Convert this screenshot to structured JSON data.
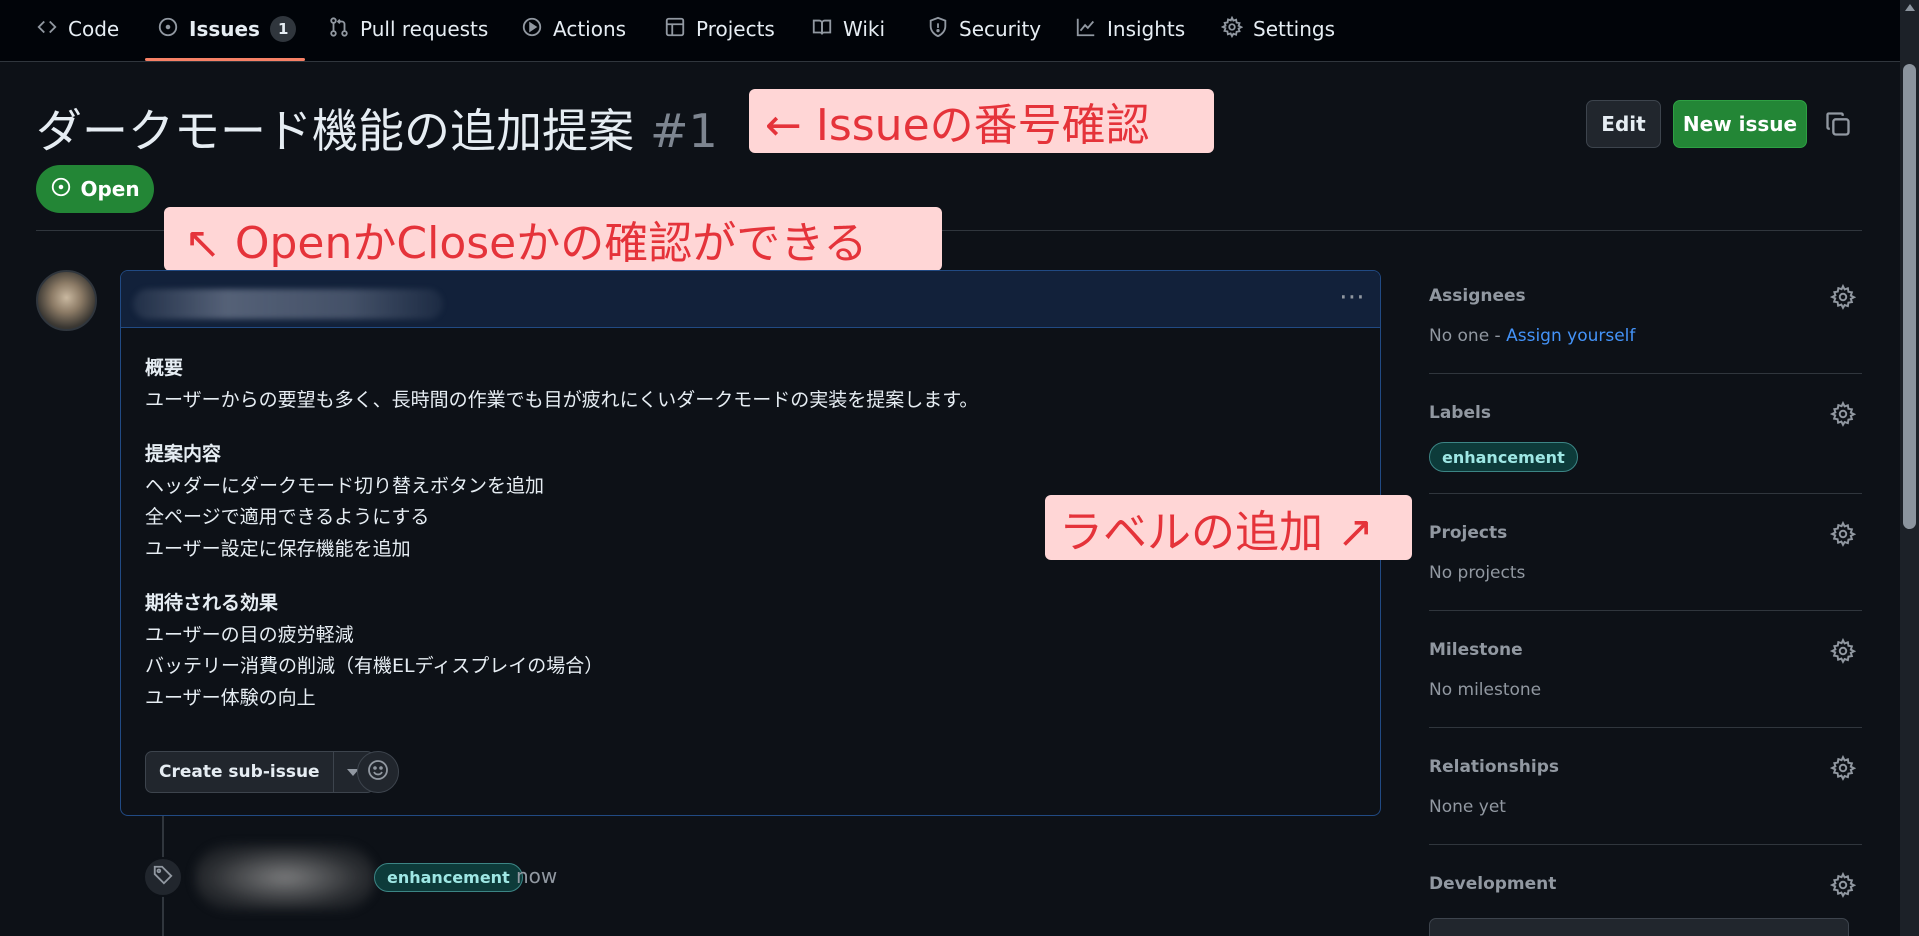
{
  "nav": {
    "tabs": [
      {
        "label": "Code",
        "icon": "code-icon"
      },
      {
        "label": "Issues",
        "icon": "issue-opened-icon",
        "count": "1"
      },
      {
        "label": "Pull requests",
        "icon": "git-pull-request-icon"
      },
      {
        "label": "Actions",
        "icon": "play-icon"
      },
      {
        "label": "Projects",
        "icon": "table-icon"
      },
      {
        "label": "Wiki",
        "icon": "book-icon"
      },
      {
        "label": "Security",
        "icon": "shield-icon"
      },
      {
        "label": "Insights",
        "icon": "graph-icon"
      },
      {
        "label": "Settings",
        "icon": "gear-icon"
      }
    ],
    "active_tab": "Issues"
  },
  "issue": {
    "title": "ダークモード機能の追加提案",
    "number": "#1",
    "state": "Open",
    "edit_label": "Edit",
    "new_issue_label": "New issue"
  },
  "annotations": {
    "number_note": "← Issueの番号確認",
    "state_note": "↖ OpenかCloseかの確認ができる",
    "label_note": "ラベルの追加 ↗"
  },
  "comment": {
    "heading1": "概要",
    "line1": "ユーザーからの要望も多く、長時間の作業でも目が疲れにくいダークモードの実装を提案します。",
    "heading2": "提案内容",
    "line2": "ヘッダーにダークモード切り替えボタンを追加",
    "line3": "全ページで適用できるようにする",
    "line4": "ユーザー設定に保存機能を追加",
    "heading3": "期待される効果",
    "line5": "ユーザーの目の疲労軽減",
    "line6": "バッテリー消費の削減（有機ELディスプレイの場合）",
    "line7": "ユーザー体験の向上",
    "create_subissue_label": "Create sub-issue"
  },
  "timeline": {
    "label": "enhancement",
    "time": "now"
  },
  "sidebar": {
    "assignees": {
      "title": "Assignees",
      "value": "No one - ",
      "link": "Assign yourself"
    },
    "labels": {
      "title": "Labels",
      "label": "enhancement"
    },
    "projects": {
      "title": "Projects",
      "value": "No projects"
    },
    "milestone": {
      "title": "Milestone",
      "value": "No milestone"
    },
    "relationships": {
      "title": "Relationships",
      "value": "None yet"
    },
    "development": {
      "title": "Development"
    }
  },
  "colors": {
    "background": "#0d1117",
    "nav_background": "#010409",
    "open_green": "#238636",
    "annotation_bg": "#ffd6d6",
    "annotation_text": "#e5333a",
    "link_blue": "#4493f8",
    "label_bg": "#0d3b3a",
    "label_text": "#9ee7e4"
  }
}
